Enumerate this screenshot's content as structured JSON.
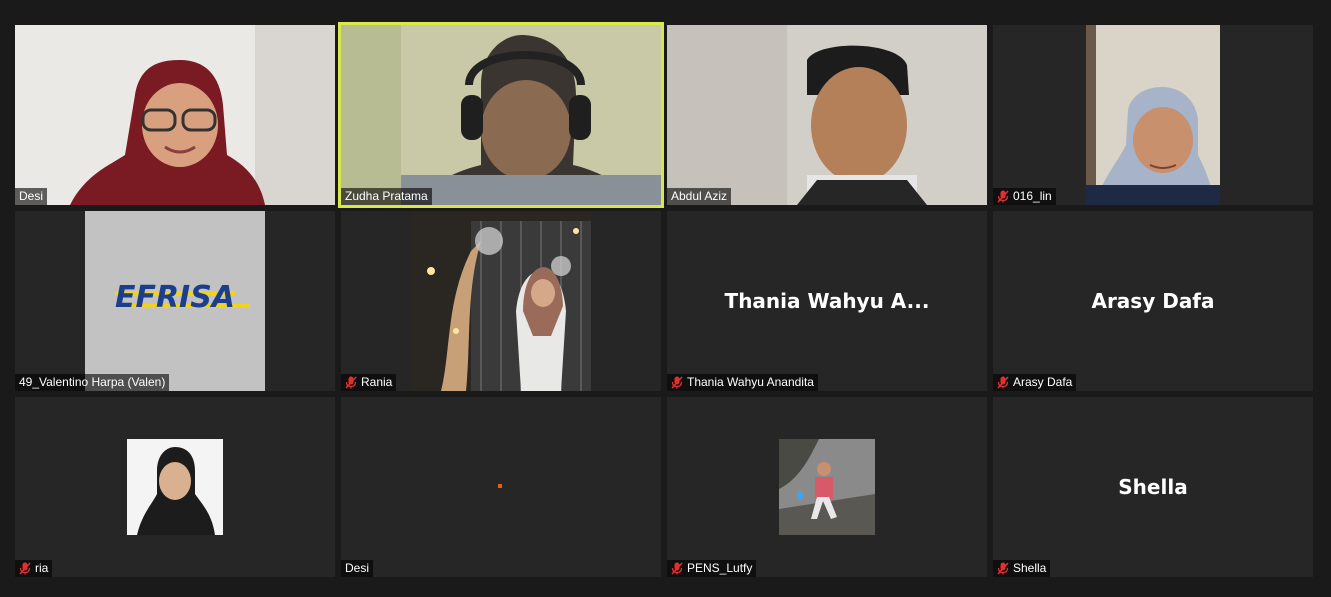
{
  "participants": [
    {
      "name": "Desi",
      "muted": false,
      "speaking": false,
      "type": "video"
    },
    {
      "name": "Zudha Pratama",
      "muted": false,
      "speaking": true,
      "type": "video"
    },
    {
      "name": "Abdul Aziz",
      "muted": false,
      "speaking": false,
      "type": "video"
    },
    {
      "name": "016_lin",
      "muted": true,
      "speaking": false,
      "type": "video"
    },
    {
      "name": "49_Valentino Harpa (Valen)",
      "muted": false,
      "speaking": false,
      "type": "video",
      "logo_text": "EFRISA"
    },
    {
      "name": "Rania",
      "muted": true,
      "speaking": false,
      "type": "video"
    },
    {
      "name": "Thania Wahyu Anandita",
      "display_name": "Thania  Wahyu  A...",
      "muted": true,
      "speaking": false,
      "type": "name"
    },
    {
      "name": "Arasy Dafa",
      "display_name": "Arasy Dafa",
      "muted": true,
      "speaking": false,
      "type": "name"
    },
    {
      "name": "ria",
      "muted": true,
      "speaking": false,
      "type": "photo"
    },
    {
      "name": "Desi",
      "muted": false,
      "speaking": false,
      "type": "blank"
    },
    {
      "name": "PENS_Lutfy",
      "muted": true,
      "speaking": false,
      "type": "photo"
    },
    {
      "name": "Shella",
      "display_name": "Shella",
      "muted": true,
      "speaking": false,
      "type": "name"
    }
  ],
  "colors": {
    "speaking_border": "#d6e84a",
    "mute_icon": "#e03030",
    "tile_bg": "#262626"
  }
}
